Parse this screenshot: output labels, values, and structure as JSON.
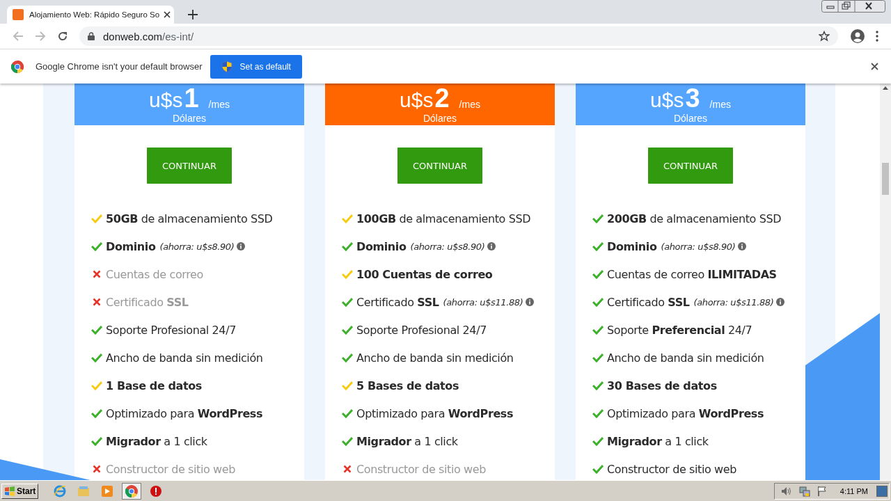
{
  "browser": {
    "tab_title": "Alojamiento Web: Rápido Seguro So",
    "url_host": "donweb.com",
    "url_path": "/es-int/"
  },
  "infobar": {
    "message": "Google Chrome isn't your default browser",
    "button": "Set as default"
  },
  "plans": [
    {
      "color": "#55a5ff",
      "currency": "u$s",
      "amount": "1",
      "period": "/mes",
      "unit": "Dólares",
      "button": "CONTINUAR",
      "features": [
        {
          "kind": "partial",
          "text": "**50GB** de almacenamiento SSD"
        },
        {
          "kind": "yes",
          "text": "Dominio",
          "bold": true,
          "note": "(ahorra: u$s8.90)"
        },
        {
          "kind": "no",
          "text": "Cuentas de correo"
        },
        {
          "kind": "no",
          "text": "Certificado **SSL**"
        },
        {
          "kind": "yes",
          "text": "Soporte Profesional 24/7"
        },
        {
          "kind": "yes",
          "text": "Ancho de banda sin medición"
        },
        {
          "kind": "partial",
          "text": "1 Base de datos",
          "bold": true
        },
        {
          "kind": "yes",
          "text": "Optimizado para **WordPress**"
        },
        {
          "kind": "yes",
          "text": "**Migrador** a 1 click"
        },
        {
          "kind": "no",
          "text": "Constructor de sitio web"
        }
      ]
    },
    {
      "color": "#ff6600",
      "currency": "u$s",
      "amount": "2",
      "period": "/mes",
      "unit": "Dólares",
      "button": "CONTINUAR",
      "features": [
        {
          "kind": "partial",
          "text": "**100GB** de almacenamiento SSD"
        },
        {
          "kind": "yes",
          "text": "Dominio",
          "bold": true,
          "note": "(ahorra: u$s8.90)"
        },
        {
          "kind": "partial",
          "text": "100 Cuentas de correo",
          "bold": true
        },
        {
          "kind": "yes",
          "text": "Certificado **SSL**",
          "note": "(ahorra: u$s11.88)"
        },
        {
          "kind": "yes",
          "text": "Soporte Profesional 24/7"
        },
        {
          "kind": "yes",
          "text": "Ancho de banda sin medición"
        },
        {
          "kind": "partial",
          "text": "5 Bases de datos",
          "bold": true
        },
        {
          "kind": "yes",
          "text": "Optimizado para **WordPress**"
        },
        {
          "kind": "yes",
          "text": "**Migrador** a 1 click"
        },
        {
          "kind": "no",
          "text": "Constructor de sitio web"
        }
      ]
    },
    {
      "color": "#55a5ff",
      "currency": "u$s",
      "amount": "3",
      "period": "/mes",
      "unit": "Dólares",
      "button": "CONTINUAR",
      "features": [
        {
          "kind": "yes",
          "text": "**200GB** de almacenamiento SSD"
        },
        {
          "kind": "yes",
          "text": "Dominio",
          "bold": true,
          "note": "(ahorra: u$s8.90)"
        },
        {
          "kind": "yes",
          "text": "Cuentas de correo **ILIMITADAS**"
        },
        {
          "kind": "yes",
          "text": "Certificado **SSL**",
          "note": "(ahorra: u$s11.88)"
        },
        {
          "kind": "yes",
          "text": "Soporte **Preferencial** 24/7"
        },
        {
          "kind": "yes",
          "text": "Ancho de banda sin medición"
        },
        {
          "kind": "yes",
          "text": "30 Bases de datos",
          "bold": true
        },
        {
          "kind": "yes",
          "text": "Optimizado para **WordPress**"
        },
        {
          "kind": "yes",
          "text": "**Migrador** a 1 click"
        },
        {
          "kind": "yes",
          "text": "Constructor de sitio web"
        }
      ]
    }
  ],
  "taskbar": {
    "start": "Start",
    "clock": "4:11 PM"
  }
}
